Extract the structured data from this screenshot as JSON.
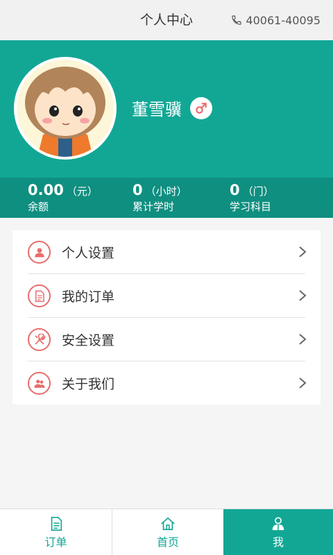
{
  "header": {
    "title": "个人中心",
    "phone": "40061-40095",
    "phone_icon": "phone-icon"
  },
  "profile": {
    "name": "董雪骥",
    "gender_icon": "male-icon",
    "avatar": "avatar-cartoon-girl"
  },
  "stats": [
    {
      "value": "0.00",
      "unit": "（元）",
      "label": "余额"
    },
    {
      "value": "0",
      "unit": "（小时）",
      "label": "累计学时"
    },
    {
      "value": "0",
      "unit": "（门）",
      "label": "学习科目"
    }
  ],
  "menu": [
    {
      "label": "个人设置",
      "icon": "person-icon"
    },
    {
      "label": "我的订单",
      "icon": "document-icon"
    },
    {
      "label": "安全设置",
      "icon": "tools-icon"
    },
    {
      "label": "关于我们",
      "icon": "group-icon"
    }
  ],
  "tabs": [
    {
      "label": "订单",
      "icon": "document-icon"
    },
    {
      "label": "首页",
      "icon": "home-icon"
    },
    {
      "label": "我",
      "icon": "user-icon",
      "active": true
    }
  ],
  "colors": {
    "primary": "#12a795",
    "stats_bg": "#0f8f80",
    "accent": "#e96c6c"
  }
}
